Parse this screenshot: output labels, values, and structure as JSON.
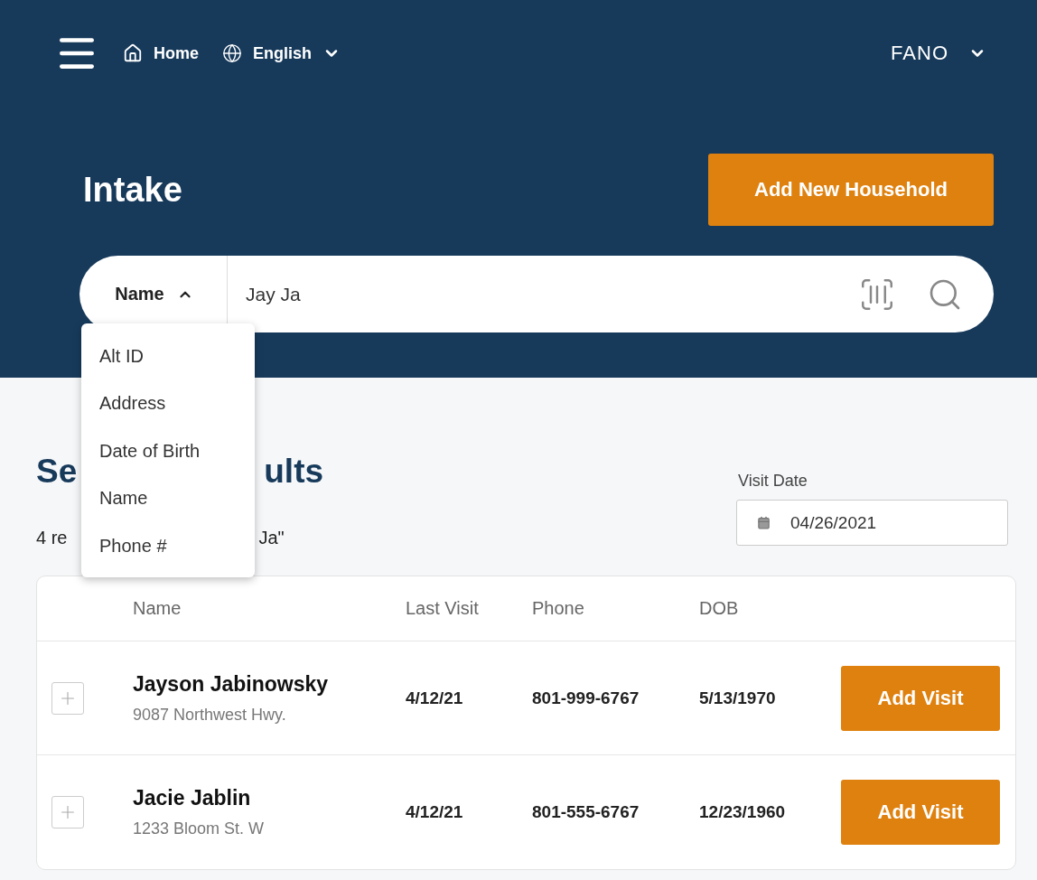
{
  "nav": {
    "home": "Home",
    "language": "English",
    "account": "FANO"
  },
  "page_title": "Intake",
  "add_household_button": "Add New Household",
  "search": {
    "field_selector": {
      "label": "Name",
      "expanded": true
    },
    "value": "Jay Ja",
    "field_options": [
      {
        "label": "Alt ID"
      },
      {
        "label": "Address"
      },
      {
        "label": "Date of Birth"
      },
      {
        "label": "Name"
      },
      {
        "label": "Phone #"
      }
    ]
  },
  "visit_date": {
    "label": "Visit Date",
    "value": "04/26/2021"
  },
  "results_heading": {
    "visible_parts": [
      "Se",
      "ults"
    ]
  },
  "results_count": {
    "visible_parts": [
      "4 re",
      "Ja\""
    ]
  },
  "table": {
    "columns": [
      "Name",
      "Last Visit",
      "Phone",
      "DOB"
    ],
    "rows": [
      {
        "name": "Jayson Jabinowsky",
        "address": "9087 Northwest Hwy.",
        "last_visit": "4/12/21",
        "phone": "801-999-6767",
        "dob": "5/13/1970",
        "action": "Add Visit",
        "expanded": false
      },
      {
        "name": "Jacie Jablin",
        "address": "1233 Bloom St. W",
        "last_visit": "4/12/21",
        "phone": "801-555-6767",
        "dob": "12/23/1960",
        "action": "Add Visit",
        "expanded": false
      }
    ]
  }
}
